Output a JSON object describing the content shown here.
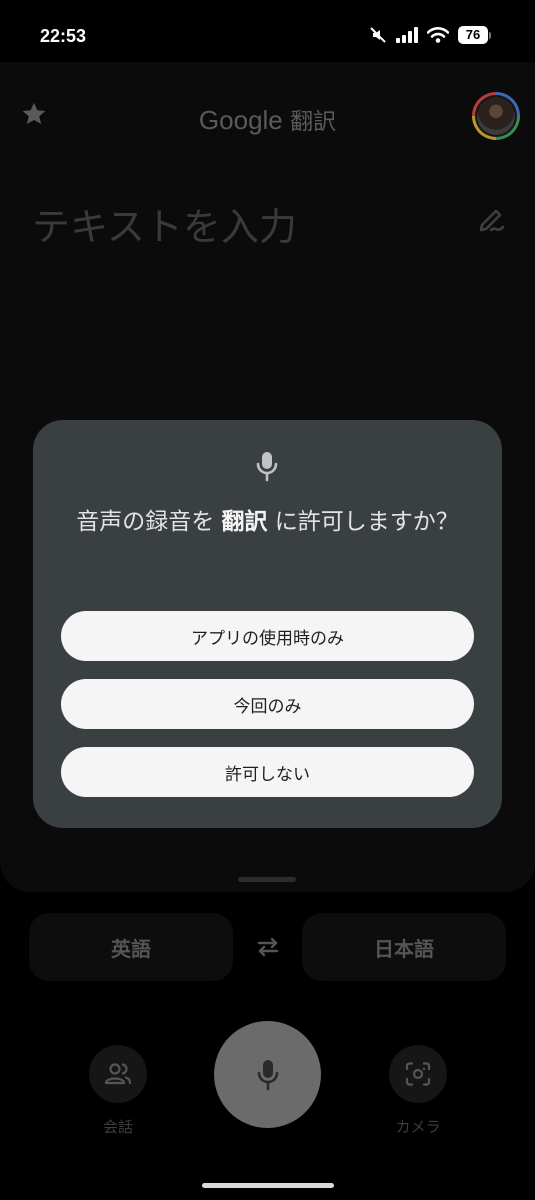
{
  "status_bar": {
    "time": "22:53",
    "battery": "76",
    "icons": [
      "mute-icon",
      "signal-icon",
      "wifi-icon",
      "battery-icon"
    ]
  },
  "header": {
    "brand": "Google",
    "title_suffix": " 翻訳",
    "left_icon": "star-icon",
    "right_icon": "account-avatar"
  },
  "input": {
    "placeholder": "テキストを入力",
    "right_icon": "handwriting-icon"
  },
  "languages": {
    "source": "英語",
    "target": "日本語",
    "swap_icon": "swap-arrows-icon"
  },
  "actions": {
    "conversation_label": "会話",
    "camera_label": "カメラ",
    "mic_icon": "mic-icon"
  },
  "dialog": {
    "icon": "mic-icon",
    "title_before": "音声の録音を ",
    "title_app": "翻訳",
    "title_after": " に許可しますか？",
    "buttons": [
      "アプリの使用時のみ",
      "今回のみ",
      "許可しない"
    ]
  },
  "colors": {
    "dialog_background": "#3a3f42",
    "pill_background": "#f5f5f5",
    "mic_button": "#6b6b6b"
  }
}
